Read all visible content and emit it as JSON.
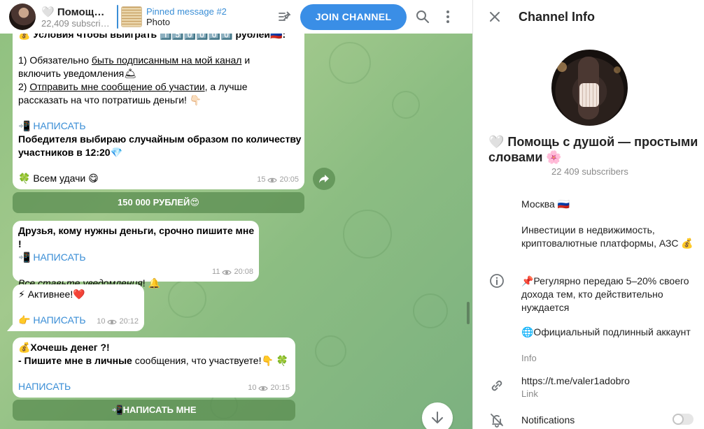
{
  "header": {
    "channel_title": "🤍 Помощь с душой — простыми словами 🌸",
    "channel_subscribers": "22,409 subscribers",
    "pinned_title": "Pinned message #2",
    "pinned_subtitle": "Photo",
    "join_label": "JOIN CHANNEL"
  },
  "messages": [
    {
      "line_top": "💰 Условия чтобы выиграть 1️⃣5️⃣0️⃣0️⃣0️⃣0️⃣ рублей🇷🇺:",
      "l1_prefix": "1) Обязательно ",
      "l1_link": "быть подписанным на мой канал",
      "l1_suffix": " и",
      "l2": "включить уведомления🛎",
      "l3_prefix": "2) ",
      "l3_link": "Отправить мне сообщение об участии",
      "l3_suffix": ", а лучше",
      "l4": "рассказать на что потратишь деньги! 👇🏻",
      "cta": "📲 НАПИСАТЬ",
      "winner1": "Победителя выбираю случайным образом по количеству",
      "winner2": "участников в 12:20💎",
      "luck": "🍀 Всем удачи 😋",
      "views": "15",
      "time": "20:05",
      "button": "150 000 РУБЛЕЙ😍"
    },
    {
      "line1": "Друзья, кому нужны деньги, срочно пишите мне !",
      "cta": "📲 НАПИСАТЬ",
      "line3_italic": "Все ставьте уведомления",
      "line3_tail": "! 🔔",
      "views": "11",
      "time": "20:08"
    },
    {
      "line1": "⚡ Активнее!❤️",
      "cta_prefix": "👉 ",
      "cta": "НАПИСАТЬ",
      "views": "10",
      "time": "20:12"
    },
    {
      "line1": "💰Хочешь денег ?!",
      "line2_bold": "- Пишите мне в личные",
      "line2_tail": " сообщения, что участвуете!👇 🍀",
      "cta": "НАПИСАТЬ",
      "views": "10",
      "time": "20:15",
      "button": "📲НАПИСАТЬ МНЕ"
    }
  ],
  "panel": {
    "title": "Channel Info",
    "channel_name": "🤍 Помощь с душой — простыми словами 🌸",
    "subscribers": "22 409 subscribers",
    "location": "Москва 🇷🇺",
    "desc1": "Инвестиции в недвижимость, криптовалютные платформы, АЗС 💰",
    "desc2": "📌Регулярно передаю 5–20% своего дохода тем, кто действительно нуждается",
    "desc3": "🌐Официальный подлинный аккаунт",
    "info_label": "Info",
    "link": "https://t.me/valer1adobro",
    "link_label": "Link",
    "notifications_label": "Notifications"
  },
  "colors": {
    "accent": "#3a8ee6",
    "link": "#3a8ed6",
    "chat_bg": "#8fc07f"
  }
}
